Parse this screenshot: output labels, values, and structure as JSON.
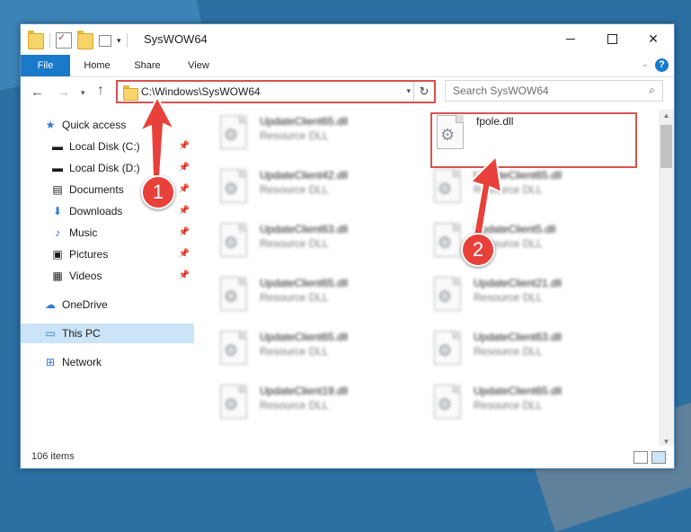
{
  "window": {
    "title": "SysWOW64",
    "buttons": {
      "minimize": "",
      "maximize": "",
      "close": "✕"
    }
  },
  "ribbon": {
    "tabs": [
      "File",
      "Home",
      "Share",
      "View"
    ],
    "help": "?"
  },
  "address": {
    "path": "C:\\Windows\\SysWOW64",
    "search_placeholder": "Search SysWOW64"
  },
  "sidebar": {
    "quick_access": "Quick access",
    "items": [
      {
        "label": "Local Disk (C:)",
        "icon": "drive-icon"
      },
      {
        "label": "Local Disk (D:)",
        "icon": "drive-icon"
      },
      {
        "label": "Documents",
        "icon": "documents-icon"
      },
      {
        "label": "Downloads",
        "icon": "downloads-icon"
      },
      {
        "label": "Music",
        "icon": "music-icon"
      },
      {
        "label": "Pictures",
        "icon": "pictures-icon"
      },
      {
        "label": "Videos",
        "icon": "videos-icon"
      }
    ],
    "onedrive": "OneDrive",
    "this_pc": "This PC",
    "network": "Network"
  },
  "files": {
    "col1": [
      {
        "name": "UpdateClient65.dll",
        "type": "Resource DLL"
      },
      {
        "name": "UpdateClient42.dll",
        "type": "Resource DLL"
      },
      {
        "name": "UpdateClient63.dll",
        "type": "Resource DLL"
      },
      {
        "name": "UpdateClient65.dll",
        "type": "Resource DLL"
      },
      {
        "name": "UpdateClient65.dll",
        "type": "Resource DLL"
      },
      {
        "name": "UpdateClient19.dll",
        "type": "Resource DLL"
      }
    ],
    "col2": [
      {
        "name": "fpole.dll",
        "type": ""
      },
      {
        "name": "UpdateClient65.dll",
        "type": "Resource DLL"
      },
      {
        "name": "UpdateClient5.dll",
        "type": "Resource DLL"
      },
      {
        "name": "UpdateClient21.dll",
        "type": "Resource DLL"
      },
      {
        "name": "UpdateClient63.dll",
        "type": "Resource DLL"
      },
      {
        "name": "UpdateClient65.dll",
        "type": "Resource DLL"
      }
    ]
  },
  "status": {
    "items": "106 items"
  },
  "annotations": {
    "badge1": "1",
    "badge2": "2",
    "color": "#d9534f"
  }
}
